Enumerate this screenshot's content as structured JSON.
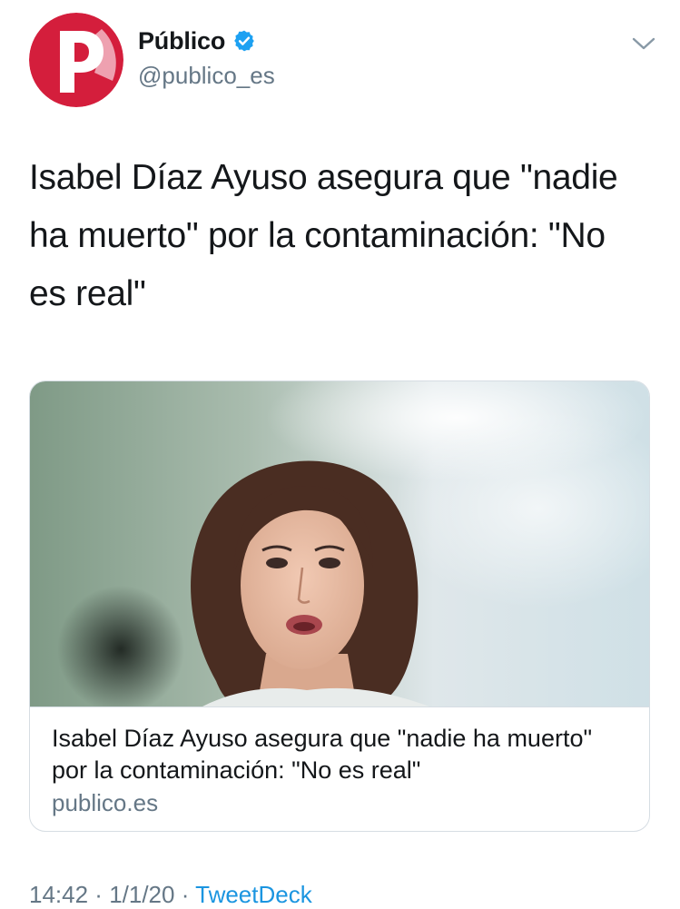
{
  "account": {
    "display_name": "Público",
    "handle": "@publico_es",
    "verified": true,
    "logo_letter": "P"
  },
  "tweet": {
    "text": "Isabel Díaz Ayuso asegura que \"nadie ha muerto\" por la contaminación: \"No es real\"",
    "time": "14:42",
    "date": "1/1/20",
    "source": "TweetDeck",
    "separator": " · "
  },
  "card": {
    "title": "Isabel Díaz Ayuso asegura que \"nadie ha muerto\" por la contaminación: \"No es real\"",
    "domain": "publico.es"
  },
  "icons": {
    "verified": "verified-badge-icon",
    "menu": "chevron-down-icon"
  },
  "colors": {
    "brand_red": "#d41e3c",
    "verified_blue": "#1da1f2",
    "link_blue": "#1b95e0",
    "secondary_text": "#657786"
  }
}
